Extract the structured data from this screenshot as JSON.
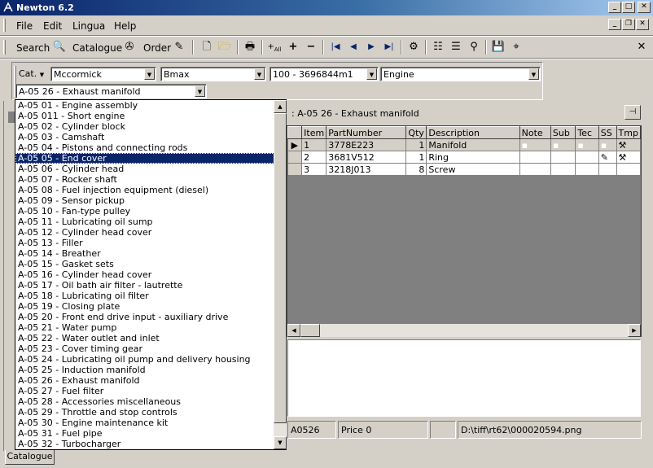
{
  "window": {
    "title": "Newton 6.2"
  },
  "menu": {
    "items": [
      "File",
      "Edit",
      "Lingua",
      "Help"
    ]
  },
  "toolbar": {
    "search_label": "Search",
    "catalogue_label": "Catalogue",
    "order_label": "Order"
  },
  "filters": {
    "cat_label": "Cat.",
    "brand": "Mccormick",
    "model": "Bmax",
    "serial_range": "100 - 3696844m1",
    "group": "Engine",
    "section": "A-05 26 - Exhaust manifold"
  },
  "panel": {
    "title": ": A-05 26 - Exhaust manifold"
  },
  "grid": {
    "columns": [
      "Item",
      "PartNumber",
      "Qty",
      "Description",
      "Note",
      "Sub",
      "Tec",
      "SS",
      "Tmp"
    ],
    "rows": [
      {
        "item": "1",
        "part": "3778E223",
        "qty": "1",
        "desc": "Manifold"
      },
      {
        "item": "2",
        "part": "3681V512",
        "qty": "1",
        "desc": "Ring"
      },
      {
        "item": "3",
        "part": "3218J013",
        "qty": "8",
        "desc": "Screw"
      }
    ]
  },
  "status": {
    "code": "A0526",
    "price": "Price 0",
    "path": "D:\\tiff\\rt62\\000020594.png"
  },
  "dropdown": {
    "selected_index": 5,
    "items": [
      "A-05 01 - Engine assembly",
      "A-05 011 - Short engine",
      "A-05 02 - Cylinder block",
      "A-05 03 - Camshaft",
      "A-05 04 - Pistons and connecting rods",
      "A-05 05 - End cover",
      "A-05 06 - Cylinder head",
      "A-05 07 - Rocker shaft",
      "A-05 08 - Fuel injection equipment (diesel)",
      "A-05 09 - Sensor pickup",
      "A-05 10 - Fan-type pulley",
      "A-05 11 - Lubricating oil sump",
      "A-05 12 - Cylinder head cover",
      "A-05 13 - Filler",
      "A-05 14 - Breather",
      "A-05 15 - Gasket sets",
      "A-05 16 - Cylinder head cover",
      "A-05 17 - Oil bath air filter - lautrette",
      "A-05 18 - Lubricating oil filter",
      "A-05 19 - Closing plate",
      "A-05 20 - Front end drive input - auxiliary drive",
      "A-05 21 - Water pump",
      "A-05 22 - Water outlet and inlet",
      "A-05 23 - Cover timing gear",
      "A-05 24 - Lubricating oil pump and delivery housing",
      "A-05 25 - Induction manifold",
      "A-05 26 - Exhaust manifold",
      "A-05 27 - Fuel filter",
      "A-05 28 - Accessories miscellaneous",
      "A-05 29 - Throttle and stop controls",
      "A-05 30 - Engine maintenance kit",
      "A-05 31 - Fuel pipe",
      "A-05 32 - Turbocharger"
    ]
  },
  "tabs": {
    "bottom": "Catalogue"
  }
}
